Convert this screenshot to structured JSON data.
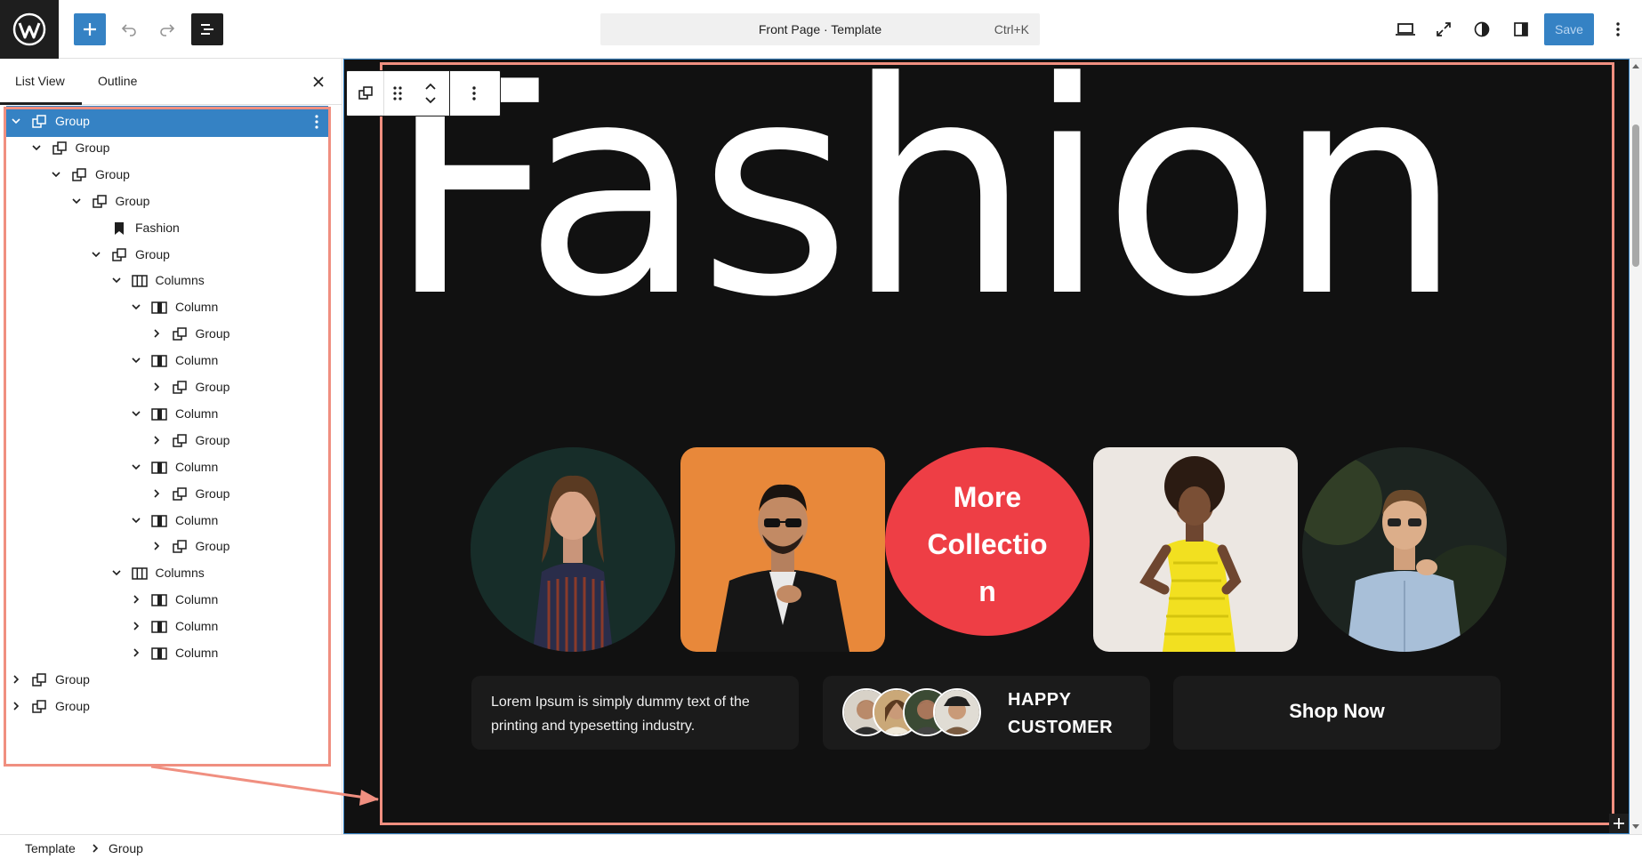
{
  "topbar": {
    "document_title": "Front Page · Template",
    "shortcut": "Ctrl+K",
    "save_label": "Save"
  },
  "left_panel": {
    "tabs": [
      {
        "label": "List View",
        "active": true
      },
      {
        "label": "Outline",
        "active": false
      }
    ],
    "tree": [
      {
        "label": "Group",
        "icon": "group-icon",
        "chevron": "down",
        "selected": true
      },
      {
        "label": "Group",
        "icon": "group-icon",
        "chevron": "down"
      },
      {
        "label": "Group",
        "icon": "group-icon",
        "chevron": "down"
      },
      {
        "label": "Group",
        "icon": "group-icon",
        "chevron": "down"
      },
      {
        "label": "Fashion",
        "icon": "bookmark-icon",
        "chevron": "none"
      },
      {
        "label": "Group",
        "icon": "group-icon",
        "chevron": "down"
      },
      {
        "label": "Columns",
        "icon": "columns-icon",
        "chevron": "down"
      },
      {
        "label": "Column",
        "icon": "column-icon",
        "chevron": "down"
      },
      {
        "label": "Group",
        "icon": "group-icon",
        "chevron": "right"
      },
      {
        "label": "Column",
        "icon": "column-icon",
        "chevron": "down"
      },
      {
        "label": "Group",
        "icon": "group-icon",
        "chevron": "right"
      },
      {
        "label": "Column",
        "icon": "column-icon",
        "chevron": "down"
      },
      {
        "label": "Group",
        "icon": "group-icon",
        "chevron": "right"
      },
      {
        "label": "Column",
        "icon": "column-icon",
        "chevron": "down"
      },
      {
        "label": "Group",
        "icon": "group-icon",
        "chevron": "right"
      },
      {
        "label": "Column",
        "icon": "column-icon",
        "chevron": "down"
      },
      {
        "label": "Group",
        "icon": "group-icon",
        "chevron": "right"
      },
      {
        "label": "Columns",
        "icon": "columns-icon",
        "chevron": "down"
      },
      {
        "label": "Column",
        "icon": "column-icon",
        "chevron": "right"
      },
      {
        "label": "Column",
        "icon": "column-icon",
        "chevron": "right"
      },
      {
        "label": "Column",
        "icon": "column-icon",
        "chevron": "right"
      },
      {
        "label": "Group",
        "icon": "group-icon",
        "chevron": "right"
      },
      {
        "label": "Group",
        "icon": "group-icon",
        "chevron": "right"
      }
    ]
  },
  "breadcrumbs": [
    "Template",
    "Group"
  ],
  "canvas": {
    "hero_title": "Fashion",
    "more_collection_lines": [
      "More",
      "Collectio",
      "n"
    ],
    "description": "Lorem Ipsum is simply dummy text of the printing and typesetting industry.",
    "happy_customer_lines": [
      "HAPPY",
      "CUSTOMER"
    ],
    "shop_now": "Shop Now"
  },
  "colors": {
    "accent": "#3582c4",
    "canvas_bg": "#111111",
    "more_circle": "#ee3e45",
    "annotation": "#f08f80"
  }
}
